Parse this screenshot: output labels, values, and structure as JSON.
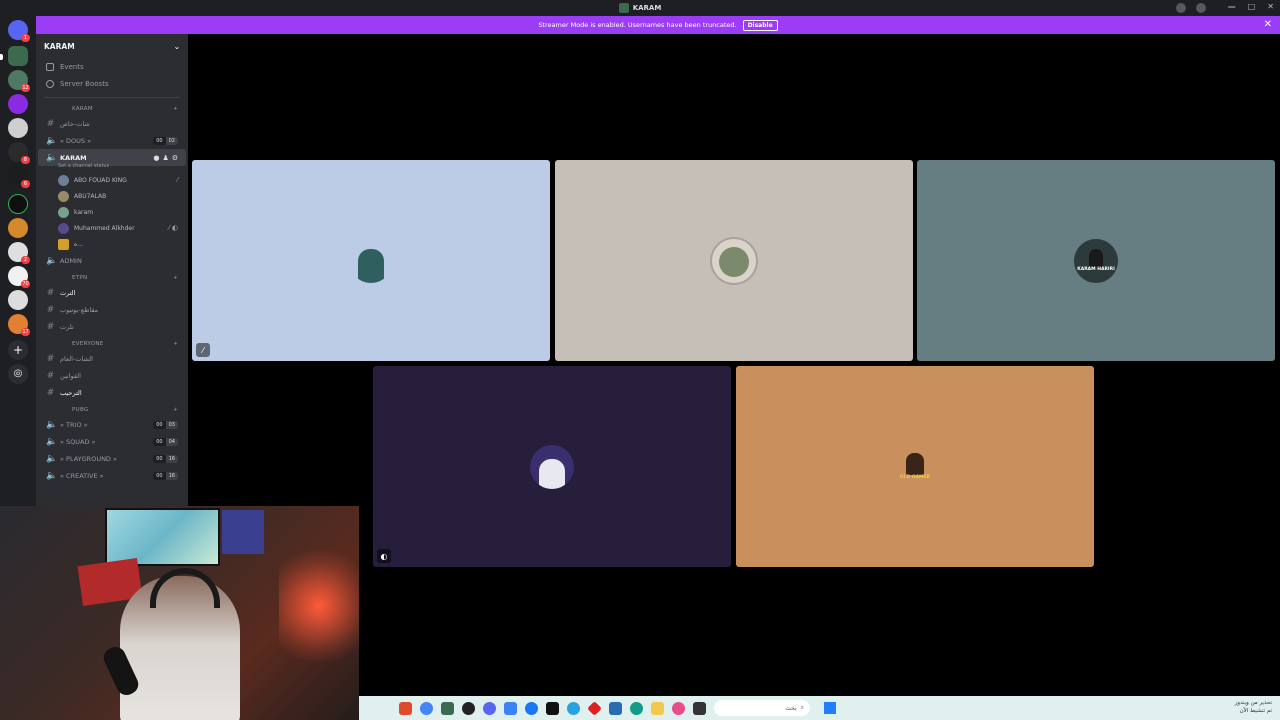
{
  "window": {
    "title": "KARAM"
  },
  "banner": {
    "text": "Streamer Mode is enabled. Usernames have been truncated.",
    "button": "Disable"
  },
  "servers": [
    {
      "color": "#5865f2",
      "badge": "1"
    },
    {
      "color": "#3c6a4e",
      "badge": ""
    },
    {
      "color": "#4e7a64",
      "badge": "12"
    },
    {
      "color": "#8a2be2",
      "badge": ""
    },
    {
      "color": "#cfcfcf",
      "badge": ""
    },
    {
      "color": "#2b2b2b",
      "badge": "8"
    },
    {
      "color": "#1d1d1d",
      "badge": "6"
    },
    {
      "color": "#0f0f0f",
      "badge": ""
    },
    {
      "color": "#d48a2a",
      "badge": ""
    },
    {
      "color": "#dfdfdf",
      "badge": "2"
    },
    {
      "color": "#f0f0f0",
      "badge": "70"
    },
    {
      "color": "#e08030",
      "badge": "17"
    }
  ],
  "sidebar": {
    "guild_name": "KARAM",
    "nav": [
      {
        "label": "Events"
      },
      {
        "label": "Server Boosts"
      }
    ],
    "categories": {
      "karam": "KARAM",
      "etpn": "ETPN",
      "everyone": "EVERYONE",
      "pubg": "PUBG"
    },
    "channels": {
      "c1": "شات-خاص",
      "dous": "« DOUS »",
      "dous_counts": [
        "00",
        "02"
      ],
      "karam": "KARAM",
      "karam_status": "Set a channel status",
      "admin": "ADMIN",
      "e1": "الترت",
      "e2": "مقاطع-يوتيوب",
      "e3": "تلرت",
      "v1": "الشات-العام",
      "v2": "القوانين",
      "v3": "الترحيب",
      "trio": "« TRIO »",
      "trio_counts": [
        "00",
        "03"
      ],
      "squad": "« SQUAD »",
      "squad_counts": [
        "00",
        "04"
      ],
      "playground": "« PLAYGROUND »",
      "playground_counts": [
        "00",
        "16"
      ],
      "creative": "« CREATIVE »",
      "creative_counts": [
        "00",
        "16"
      ]
    },
    "members": [
      {
        "name": "ABO FOUAD KING",
        "color": "#6b7f99"
      },
      {
        "name": "ABU7ALAB",
        "color": "#9a8a6a"
      },
      {
        "name": "karam",
        "color": "#7aa08a"
      },
      {
        "name": "Muhammed Alkhder",
        "color": "#5a4a8a"
      },
      {
        "name": "ه...",
        "color": "#d4a02a"
      }
    ]
  },
  "tiles": [
    {
      "bg": "#bccbe6",
      "avatar": "#2f5f5f"
    },
    {
      "bg": "#c5bfb8",
      "avatar": "#d9d3c9"
    },
    {
      "bg": "#667d81",
      "avatar": "#2c3a3c",
      "label": "KARAM HARIRI"
    },
    {
      "bg": "#271e3b",
      "avatar": "#3a2e6e"
    },
    {
      "bg": "#c98f5c",
      "avatar": "#3a2418",
      "label": "OLD GAMER"
    }
  ],
  "taskbar": {
    "search_placeholder": "بحث",
    "tray_line1": "تحذير من ويندوز",
    "tray_line2": "تم تنشيط الآن"
  }
}
